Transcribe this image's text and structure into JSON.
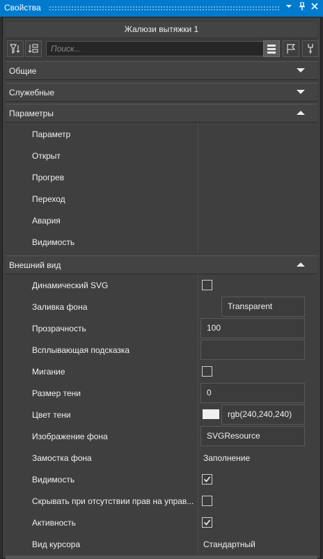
{
  "window": {
    "title": "Свойства",
    "menu_icon": "chevron-down-icon",
    "pin_icon": "pin-icon",
    "close_icon": "close-icon"
  },
  "object_name": "Жалюзи вытяжки 1",
  "toolbar": {
    "filter_icon": "filter-icon",
    "sort_icon": "sort-icon",
    "search_placeholder": "Поиск...",
    "list_view_icon": "list-view-icon",
    "events_icon": "flag-icon",
    "properties_icon": "wrench-icon"
  },
  "sections": {
    "general": {
      "label": "Общие",
      "expanded": false
    },
    "service": {
      "label": "Служебные",
      "expanded": false
    },
    "parameters": {
      "label": "Параметры",
      "expanded": true,
      "rows": [
        {
          "name": "Параметр"
        },
        {
          "name": "Открыт"
        },
        {
          "name": "Прогрев"
        },
        {
          "name": "Переход"
        },
        {
          "name": "Авария"
        },
        {
          "name": "Видимость"
        }
      ]
    },
    "appearance": {
      "label": "Внешний вид",
      "expanded": true,
      "rows": [
        {
          "name": "Динамический SVG",
          "type": "checkbox",
          "checked": false
        },
        {
          "name": "Заливка фона",
          "type": "text",
          "value": "Transparent"
        },
        {
          "name": "Прозрачность",
          "type": "text",
          "value": "100"
        },
        {
          "name": "Всплывающая подсказка",
          "type": "text",
          "value": ""
        },
        {
          "name": "Мигание",
          "type": "checkbox",
          "checked": false
        },
        {
          "name": "Размер тени",
          "type": "text",
          "value": "0"
        },
        {
          "name": "Цвет тени",
          "type": "color",
          "value": "rgb(240,240,240)",
          "swatch": "#f0f0f0"
        },
        {
          "name": "Изображение фона",
          "type": "text",
          "value": "SVGResource"
        },
        {
          "name": "Замостка фона",
          "type": "plain",
          "value": "Заполнение"
        },
        {
          "name": "Видимость",
          "type": "checkbox",
          "checked": true
        },
        {
          "name": "Скрывать при отсутствии прав на управ...",
          "type": "checkbox",
          "checked": false
        },
        {
          "name": "Активность",
          "type": "checkbox",
          "checked": true
        },
        {
          "name": "Вид курсора",
          "type": "plain",
          "value": "Стандартный"
        }
      ]
    }
  },
  "colors": {
    "titlebar": "#007acc",
    "panel": "#3f3f3f",
    "section_header": "#434343",
    "text": "#f0f0f0"
  }
}
